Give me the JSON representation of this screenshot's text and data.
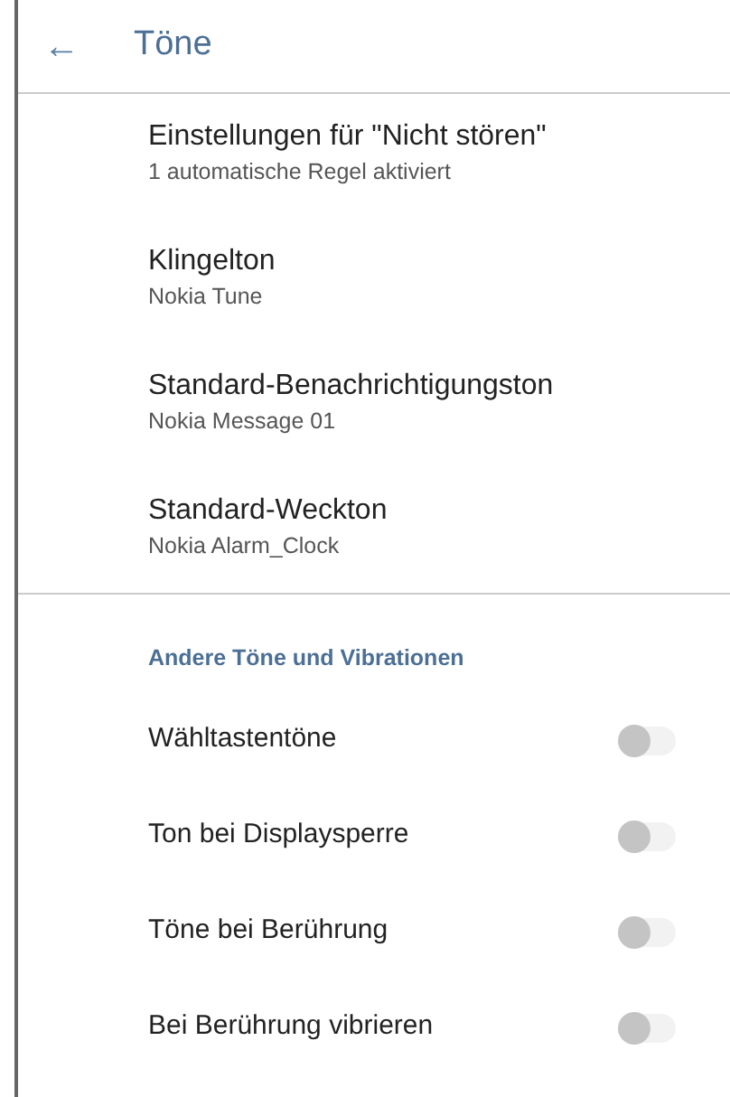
{
  "app_bar": {
    "back_icon": "←",
    "title": "Töne"
  },
  "preferences": [
    {
      "title": "Einstellungen für \"Nicht stören\"",
      "summary": "1 automatische Regel aktiviert"
    },
    {
      "title": "Klingelton",
      "summary": "Nokia Tune"
    },
    {
      "title": "Standard-Benachrichtigungston",
      "summary": "Nokia Message 01"
    },
    {
      "title": "Standard-Weckton",
      "summary": "Nokia Alarm_Clock"
    }
  ],
  "section": {
    "header": "Andere Töne und Vibrationen",
    "switches": [
      {
        "label": "Wähltastentöne",
        "on": false
      },
      {
        "label": "Ton bei Displaysperre",
        "on": false
      },
      {
        "label": "Töne bei Berührung",
        "on": false
      },
      {
        "label": "Bei Berührung vibrieren",
        "on": false
      }
    ]
  }
}
